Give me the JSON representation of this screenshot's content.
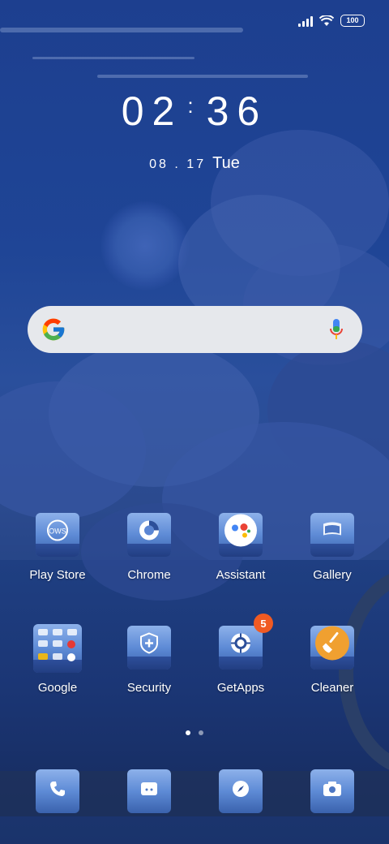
{
  "status_bar": {
    "battery": "100"
  },
  "lockscreen": {
    "time_hours": "02",
    "time_minutes": "36",
    "date": "08 . 17",
    "weekday": "Tue"
  },
  "search": {
    "placeholder": ""
  },
  "apps_row1": [
    {
      "label": "Play Store",
      "icon": "play-store-icon"
    },
    {
      "label": "Chrome",
      "icon": "chrome-icon"
    },
    {
      "label": "Assistant",
      "icon": "assistant-icon"
    },
    {
      "label": "Gallery",
      "icon": "gallery-icon"
    }
  ],
  "apps_row2": [
    {
      "label": "Google",
      "icon": "google-folder-icon"
    },
    {
      "label": "Security",
      "icon": "security-icon"
    },
    {
      "label": "GetApps",
      "icon": "getapps-icon",
      "badge": "5"
    },
    {
      "label": "Cleaner",
      "icon": "cleaner-icon"
    }
  ],
  "dock": [
    {
      "icon": "phone-icon"
    },
    {
      "icon": "messages-icon"
    },
    {
      "icon": "browser-icon"
    },
    {
      "icon": "camera-icon"
    }
  ],
  "page_indicator": {
    "pages": 2,
    "current": 1
  },
  "colors": {
    "badge": "#f05a22",
    "cleaner": "#f0a030"
  }
}
